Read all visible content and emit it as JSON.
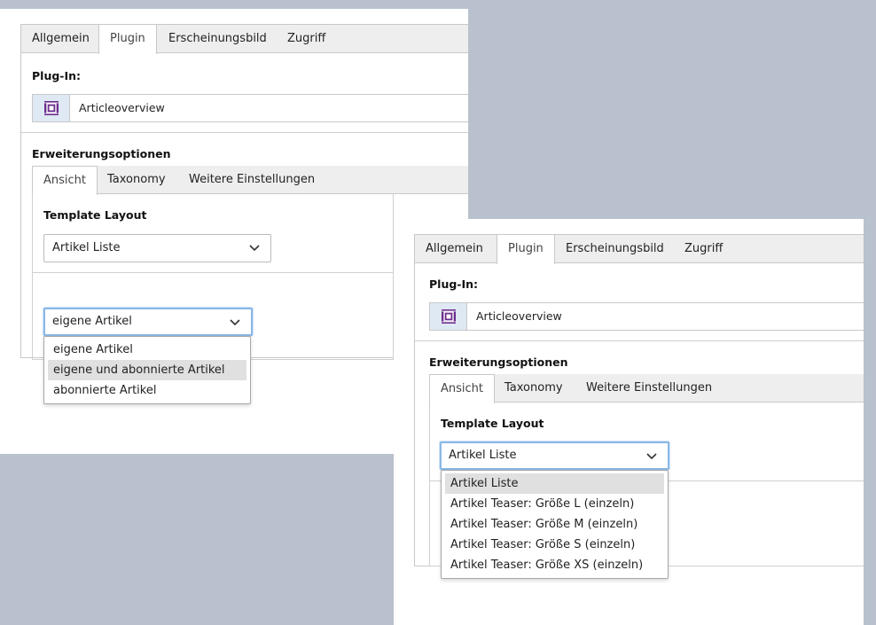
{
  "tabs": [
    "Allgemein",
    "Plugin",
    "Erscheinungsbild",
    "Zugriff"
  ],
  "active_tab_index": 1,
  "plugin": {
    "label": "Plug-In:",
    "value": "Articleoverview",
    "icon": "plugin-icon",
    "icon_color": "#6a2c8c"
  },
  "extension": {
    "label": "Erweiterungsoptionen",
    "subtabs": [
      "Ansicht",
      "Taxonomy",
      "Weitere Einstellungen"
    ],
    "active_subtab_index": 0
  },
  "template_layout": {
    "label": "Template Layout",
    "value": "Artikel Liste",
    "options": [
      "Artikel Liste",
      "Artikel Teaser: Größe L (einzeln)",
      "Artikel Teaser: Größe M (einzeln)",
      "Artikel Teaser: Größe S (einzeln)",
      "Artikel Teaser: Größe XS (einzeln)"
    ],
    "highlighted_index": 0
  },
  "article_source": {
    "value": "eigene Artikel",
    "options": [
      "eigene Artikel",
      "eigene und abonnierte Artikel",
      "abonnierte Artikel"
    ],
    "highlighted_index": 1
  },
  "colors": {
    "background": "#b8c1cd",
    "focus_border": "#8ab8e6",
    "icon_bg": "#dfe9f4"
  }
}
